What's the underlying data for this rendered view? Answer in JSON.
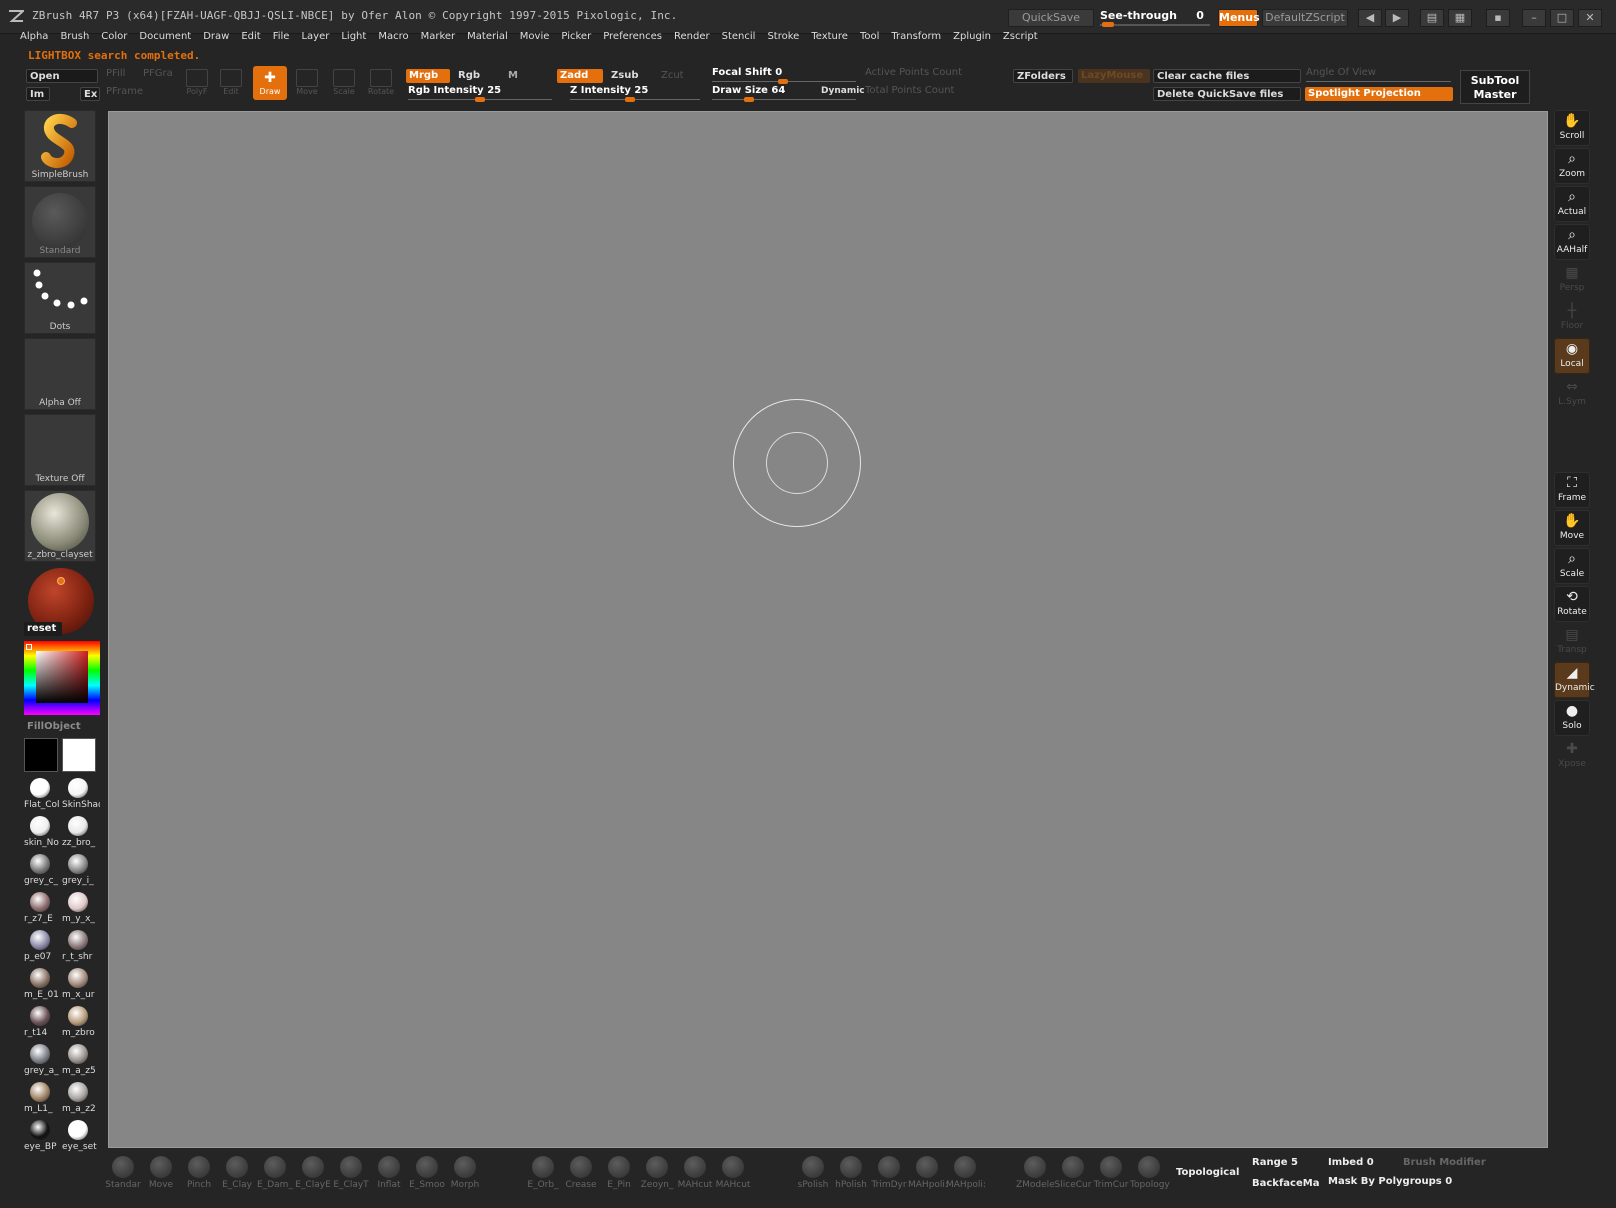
{
  "titlebar": {
    "title": "ZBrush 4R7 P3 (x64)[FZAH-UAGF-QBJJ-QSLI-NBCE] by Ofer Alon © Copyright 1997-2015 Pixologic, Inc.",
    "quicksave": "QuickSave",
    "see_through_label": "See-through",
    "see_through_value": "0",
    "menus": "Menus",
    "default_zscript": "DefaultZScript",
    "accent": "#e3700d"
  },
  "menu": [
    "Alpha",
    "Brush",
    "Color",
    "Document",
    "Draw",
    "Edit",
    "File",
    "Layer",
    "Light",
    "Macro",
    "Marker",
    "Material",
    "Movie",
    "Picker",
    "Preferences",
    "Render",
    "Stencil",
    "Stroke",
    "Texture",
    "Tool",
    "Transform",
    "Zplugin",
    "Zscript"
  ],
  "status": "LIGHTBOX search completed.",
  "topshelf": {
    "open": "Open",
    "im": "Im",
    "ex": "Ex",
    "pfill": "PFill",
    "pfgra": "PFGra",
    "pframe": "PFrame",
    "polyf": "PolyF",
    "edit": "Edit",
    "draw": "Draw",
    "move": "Move",
    "scale": "Scale",
    "rotate": "Rotate",
    "mrgb": "Mrgb",
    "rgb": "Rgb",
    "m": "M",
    "zadd": "Zadd",
    "zsub": "Zsub",
    "zcut": "Zcut",
    "rgb_intensity_label": "Rgb Intensity",
    "rgb_intensity_value": "25",
    "z_intensity_label": "Z Intensity",
    "z_intensity_value": "25",
    "focal_shift_label": "Focal Shift",
    "focal_shift_value": "0",
    "draw_size_label": "Draw Size",
    "draw_size_value": "64",
    "dynamic": "Dynamic",
    "active_points": "Active Points Count",
    "total_points": "Total Points Count",
    "zfolders": "ZFolders",
    "lazymouse": "LazyMouse",
    "clear_cache": "Clear cache files",
    "delete_quicksave": "Delete QuickSave files",
    "angle_of_view": "Angle Of View",
    "spotlight_projection": "Spotlight Projection",
    "subtool_master_1": "SubTool",
    "subtool_master_2": "Master"
  },
  "leftpanel": {
    "brush": "SimpleBrush",
    "stroke": "Standard",
    "dots": "Dots",
    "alpha": "Alpha Off",
    "texture": "Texture Off",
    "material": "z_zbro_clayset",
    "reset": "reset",
    "fillobject": "FillObject",
    "materials": [
      {
        "name": "Flat_Col",
        "color": "#ffffff"
      },
      {
        "name": "SkinShad",
        "color": "#f4f4f4"
      },
      {
        "name": "skin_No",
        "color": "#eeeeee"
      },
      {
        "name": "zz_bro_",
        "color": "#e8e8e8"
      },
      {
        "name": "grey_c_",
        "color": "#7a7a7a"
      },
      {
        "name": "grey_i_",
        "color": "#8a8a8a"
      },
      {
        "name": "r_z7_E",
        "color": "#8f6e70"
      },
      {
        "name": "m_y_x_",
        "color": "#e0c8c8"
      },
      {
        "name": "p_e07",
        "color": "#8c8aa8"
      },
      {
        "name": "r_t_shr",
        "color": "#8d7a7c"
      },
      {
        "name": "m_E_01",
        "color": "#8a7466"
      },
      {
        "name": "m_x_ur",
        "color": "#a48a7c"
      },
      {
        "name": "r_t14",
        "color": "#6b5258"
      },
      {
        "name": "m_zbro",
        "color": "#b89c7c"
      },
      {
        "name": "grey_a_",
        "color": "#7e808a"
      },
      {
        "name": "m_a_z5",
        "color": "#9a9490"
      },
      {
        "name": "m_L1_",
        "color": "#a08466"
      },
      {
        "name": "m_a_z2",
        "color": "#a8a4a2"
      },
      {
        "name": "eye_BP",
        "color": "#111111"
      },
      {
        "name": "eye_set",
        "color": "#ffffff"
      }
    ]
  },
  "rightpanel": [
    "Scroll",
    "Zoom",
    "Actual",
    "AAHalf",
    "Persp",
    "Floor",
    "Local",
    "L.Sym",
    "Frame",
    "Move",
    "Scale",
    "Rotate",
    "Transp",
    "Dynamic",
    "Solo",
    "Xpose"
  ],
  "bottom": {
    "brushes": [
      "Standar",
      "Move",
      "Pinch",
      "E_Clay",
      "E_Dam_",
      "E_ClayE",
      "E_ClayT",
      "Inflat",
      "E_Smoo",
      "Morph",
      "E_Orb_",
      "Crease",
      "E_Pin",
      "Zeoyn_",
      "MAHcut",
      "MAHcut",
      "sPolish",
      "hPolish",
      "TrimDyr",
      "MAHpoli:",
      "MAHpoli:",
      "ZModele",
      "SliceCur",
      "TrimCur",
      "Topology"
    ],
    "topological": "Topological",
    "range_label": "Range",
    "range_value": "5",
    "imbed_label": "Imbed",
    "imbed_value": "0",
    "brush_modifier": "Brush Modifier",
    "backface": "BackfaceMa",
    "mask_by_polygroups_label": "Mask By Polygroups",
    "mask_by_polygroups_value": "0"
  }
}
